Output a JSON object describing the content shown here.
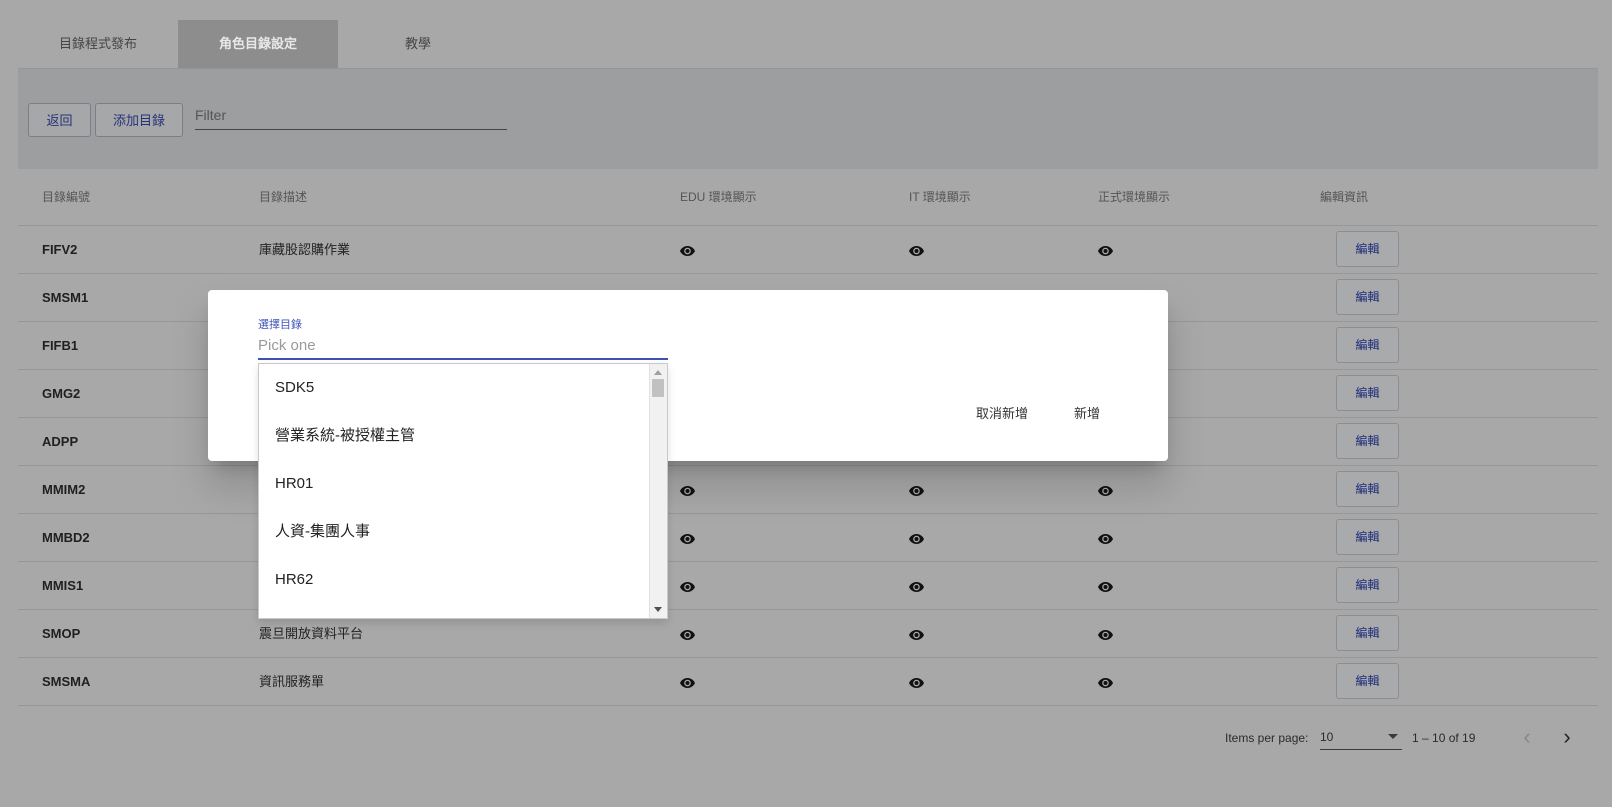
{
  "tabs": [
    {
      "label": "目錄程式發布"
    },
    {
      "label": "角色目錄設定",
      "active": true
    },
    {
      "label": "教學"
    }
  ],
  "toolbar": {
    "back_label": "返回",
    "add_label": "添加目錄",
    "filter_placeholder": "Filter"
  },
  "table": {
    "headers": [
      "目錄編號",
      "目錄描述",
      "EDU 環境顯示",
      "IT 環境顯示",
      "正式環境顯示",
      "編輯資訊"
    ],
    "rows": [
      {
        "code": "FIFV2",
        "desc": "庫藏股認購作業",
        "eye": true
      },
      {
        "code": "SMSM1",
        "desc": "",
        "eye": false
      },
      {
        "code": "FIFB1",
        "desc": "",
        "eye": false
      },
      {
        "code": "GMG2",
        "desc": "",
        "eye": false
      },
      {
        "code": "ADPP",
        "desc": "",
        "eye": false
      },
      {
        "code": "MMIM2",
        "desc": "",
        "eye": true
      },
      {
        "code": "MMBD2",
        "desc": "",
        "eye": true
      },
      {
        "code": "MMIS1",
        "desc": "",
        "eye": true
      },
      {
        "code": "SMOP",
        "desc": "震旦開放資料平台",
        "eye": true
      },
      {
        "code": "SMSMA",
        "desc": "資訊服務單",
        "eye": true
      }
    ],
    "edit_label": "編輯"
  },
  "paginator": {
    "items_per_page_label": "Items per page:",
    "page_size": "10",
    "range_label": "1 – 10 of 19"
  },
  "modal": {
    "field_label": "選擇目錄",
    "field_placeholder": "Pick one",
    "cancel_label": "取消新增",
    "add_label": "新增"
  },
  "dropdown": {
    "options": [
      "SDK5",
      "營業系統-被授權主管",
      "HR01",
      "人資-集團人事",
      "HR62"
    ]
  },
  "colors": {
    "accent": "#3f51b5",
    "overlay_bg": "#a8a8a8"
  },
  "icons": {
    "eye": "eye-icon",
    "prev": "chevron-left-icon",
    "next": "chevron-right-icon",
    "caret": "caret-down-icon"
  }
}
